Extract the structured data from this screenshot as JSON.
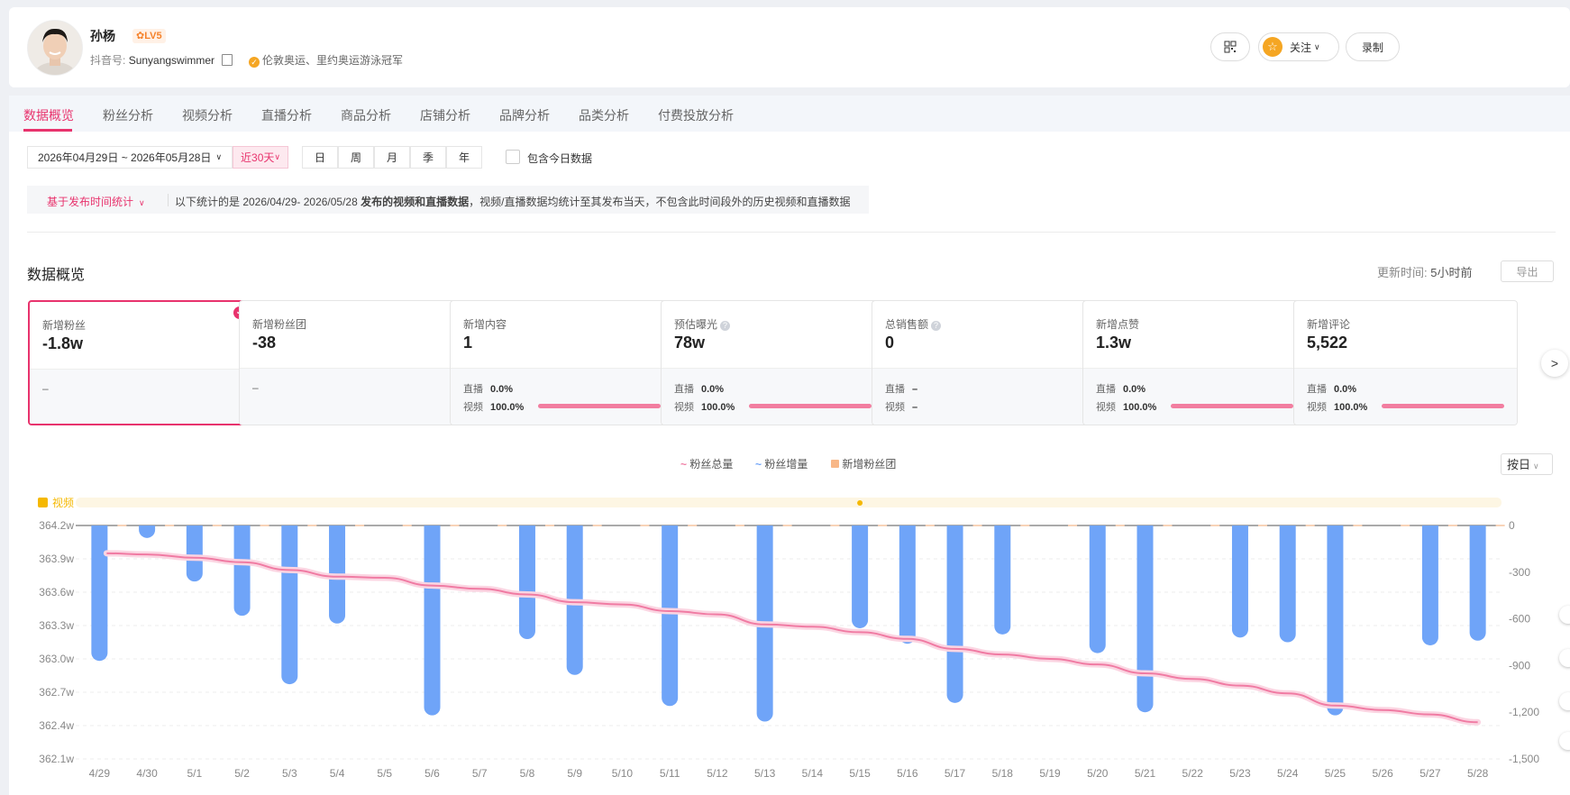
{
  "profile": {
    "name": "孙杨",
    "level": "LV5",
    "douyin_label": "抖音号:",
    "douyin_id": "Sunyangswimmer",
    "verify_text": "伦敦奥运、里约奥运游泳冠军",
    "follow_label": "关注",
    "record_label": "录制"
  },
  "tabs": [
    "数据概览",
    "粉丝分析",
    "视频分析",
    "直播分析",
    "商品分析",
    "店铺分析",
    "品牌分析",
    "品类分析",
    "付费投放分析"
  ],
  "filters": {
    "date_range": "2026年04月29日 ~ 2026年05月28日",
    "preset": "近30天",
    "periods": [
      "日",
      "周",
      "月",
      "季",
      "年"
    ],
    "include_today": "包含今日数据"
  },
  "info": {
    "basis": "基于发布时间统计",
    "text_prefix": "以下统计的是  2026/04/29- 2026/05/28 ",
    "text_bold": "发布的视频和直播数据",
    "text_suffix": "，视频/直播数据均统计至其发布当天，不包含此时间段外的历史视频和直播数据"
  },
  "section": {
    "title": "数据概览",
    "update_label": "更新时间:",
    "update_value": "5小时前",
    "export": "导出"
  },
  "cards": [
    {
      "label": "新增粉丝",
      "value": "-1.8w",
      "selected": true,
      "rows": null,
      "dash": "–"
    },
    {
      "label": "新增粉丝团",
      "value": "-38",
      "rows": null,
      "dash": "–"
    },
    {
      "label": "新增内容",
      "value": "1",
      "rows": [
        {
          "k": "直播",
          "v": "0.0%"
        },
        {
          "k": "视频",
          "v": "100.0%",
          "bar": 1.0
        }
      ]
    },
    {
      "label": "预估曝光",
      "value": "78w",
      "help": true,
      "rows": [
        {
          "k": "直播",
          "v": "0.0%"
        },
        {
          "k": "视频",
          "v": "100.0%",
          "bar": 1.0
        }
      ]
    },
    {
      "label": "总销售额",
      "value": "0",
      "help": true,
      "rows": [
        {
          "k": "直播",
          "v": "–"
        },
        {
          "k": "视频",
          "v": "–"
        }
      ]
    },
    {
      "label": "新增点赞",
      "value": "1.3w",
      "rows": [
        {
          "k": "直播",
          "v": "0.0%"
        },
        {
          "k": "视频",
          "v": "100.0%",
          "bar": 1.0
        }
      ]
    },
    {
      "label": "新增评论",
      "value": "5,522",
      "rows": [
        {
          "k": "直播",
          "v": "0.0%"
        },
        {
          "k": "视频",
          "v": "100.0%",
          "bar": 1.0
        }
      ]
    }
  ],
  "legend": {
    "total": "粉丝总量",
    "increase": "粉丝增量",
    "fanclub": "新增粉丝团",
    "byday": "按日",
    "video_tag": "视频"
  },
  "colors": {
    "accent": "#e8336d",
    "bar": "#6fa4f8",
    "line": "#f07ba3",
    "fanclub": "#f8b787",
    "video": "#f5b800"
  },
  "chart_data": {
    "type": "bar",
    "categories": [
      "4/29",
      "4/30",
      "5/1",
      "5/2",
      "5/3",
      "5/4",
      "5/5",
      "5/6",
      "5/7",
      "5/8",
      "5/9",
      "5/10",
      "5/11",
      "5/12",
      "5/13",
      "5/14",
      "5/15",
      "5/16",
      "5/17",
      "5/18",
      "5/19",
      "5/20",
      "5/21",
      "5/22",
      "5/23",
      "5/24",
      "5/25",
      "5/26",
      "5/27",
      "5/28"
    ],
    "series": [
      {
        "name": "粉丝增量",
        "type": "bar",
        "axis": "right",
        "values": [
          -870,
          -80,
          -360,
          -580,
          -1020,
          -630,
          0,
          -1220,
          0,
          -730,
          -960,
          0,
          -1160,
          0,
          -1260,
          0,
          -660,
          -760,
          -1140,
          -700,
          0,
          -820,
          -1200,
          0,
          -720,
          -750,
          -1220,
          0,
          -770,
          -740
        ]
      },
      {
        "name": "粉丝总量",
        "type": "line",
        "axis": "left",
        "unit": "w",
        "values": [
          363.95,
          363.94,
          363.91,
          363.87,
          363.8,
          363.74,
          363.73,
          363.66,
          363.63,
          363.58,
          363.51,
          363.49,
          363.43,
          363.4,
          363.31,
          363.29,
          363.24,
          363.18,
          363.09,
          363.04,
          363.0,
          362.95,
          362.87,
          362.82,
          362.76,
          362.69,
          362.58,
          362.54,
          362.5,
          362.43
        ]
      },
      {
        "name": "新增粉丝团",
        "type": "bar",
        "axis": "right",
        "values": [
          0,
          0,
          0,
          0,
          0,
          0,
          0,
          0,
          0,
          0,
          0,
          0,
          0,
          0,
          0,
          0,
          0,
          0,
          0,
          0,
          0,
          0,
          0,
          0,
          0,
          0,
          0,
          0,
          0,
          0
        ]
      }
    ],
    "video_markers": [
      "5/15"
    ],
    "yleft_ticks": [
      "364.2w",
      "363.9w",
      "363.6w",
      "363.3w",
      "363.0w",
      "362.7w",
      "362.4w",
      "362.1w"
    ],
    "yleft_lim": [
      362.1,
      364.2
    ],
    "yright_ticks": [
      "0",
      "-300",
      "-600",
      "-900",
      "-1,200",
      "-1,500"
    ],
    "yright_lim": [
      -1500,
      0
    ],
    "grid": true,
    "legend_position": "top-center"
  }
}
